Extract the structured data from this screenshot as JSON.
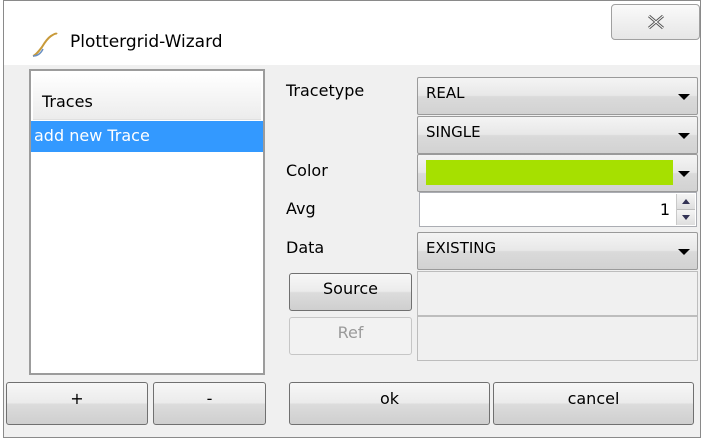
{
  "window": {
    "title": "Plottergrid-Wizard"
  },
  "traces": {
    "header": "Traces",
    "items": [
      {
        "label": "add new Trace",
        "selected": true
      }
    ],
    "add_label": "+",
    "remove_label": "-"
  },
  "form": {
    "tracetype_label": "Tracetype",
    "tracetype_value": "REAL",
    "mode_value": "SINGLE",
    "color_label": "Color",
    "color_value": "#a6e000",
    "avg_label": "Avg",
    "avg_value": "1",
    "data_label": "Data",
    "data_value": "EXISTING",
    "source_label": "Source",
    "source_path": "",
    "ref_label": "Ref",
    "ref_path": ""
  },
  "actions": {
    "ok_label": "ok",
    "cancel_label": "cancel"
  },
  "icons": {
    "title": "plot-curve-icon",
    "close": "close-icon"
  }
}
